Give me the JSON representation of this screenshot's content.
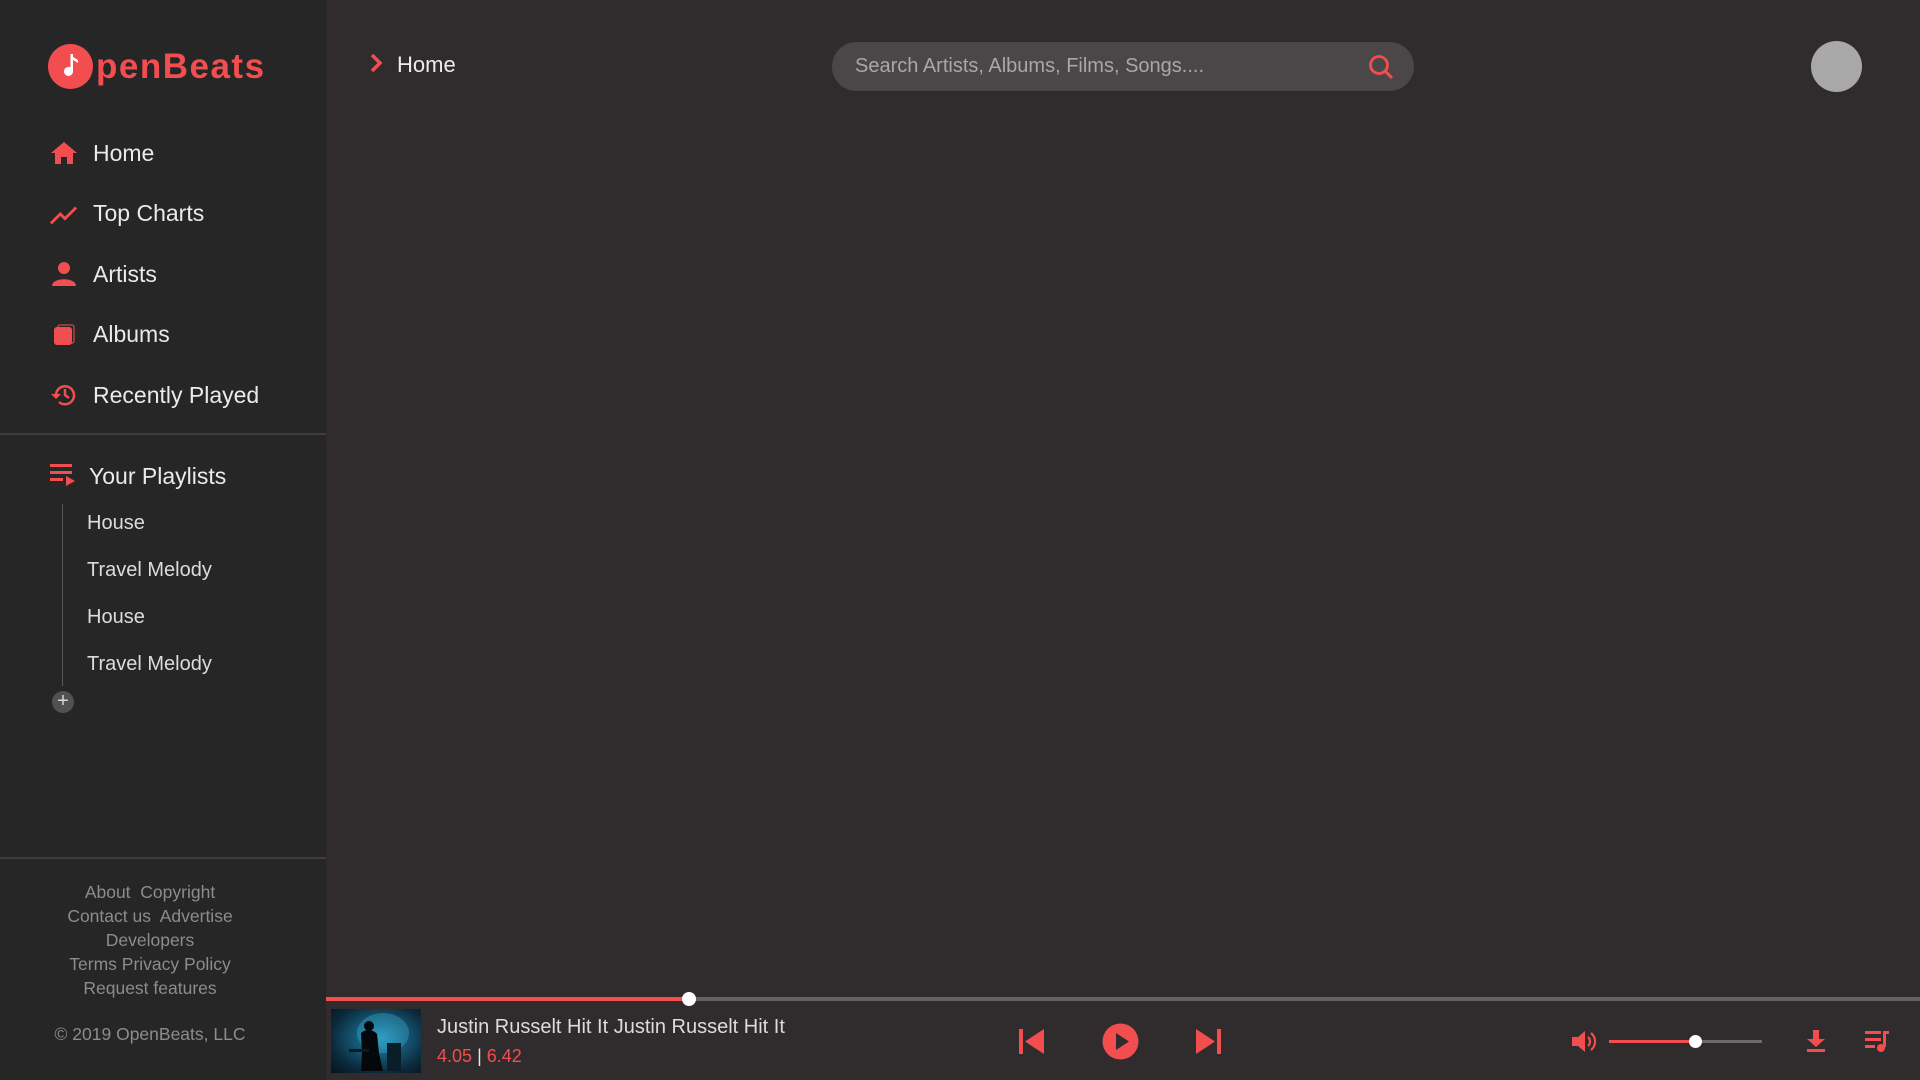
{
  "brand": {
    "logo_accent": "O",
    "logo_rest": "penBeats",
    "accent_color": "#f24e50"
  },
  "sidebar": {
    "nav": [
      {
        "label": "Home",
        "icon": "home-icon"
      },
      {
        "label": "Top Charts",
        "icon": "trending-icon"
      },
      {
        "label": "Artists",
        "icon": "person-icon"
      },
      {
        "label": "Albums",
        "icon": "album-icon"
      },
      {
        "label": "Recently Played",
        "icon": "history-icon"
      }
    ],
    "playlists_title": "Your Playlists",
    "playlists": [
      "House",
      "Travel Melody",
      "House",
      "Travel Melody"
    ],
    "add_playlist_label": "+",
    "footer": {
      "links_row1": [
        "About",
        "Copyright"
      ],
      "links_row2": [
        "Contact us",
        "Advertise"
      ],
      "links_row3": [
        "Developers"
      ],
      "links_row4": [
        "Terms",
        "Privacy Policy"
      ],
      "links_row5": [
        "Request features"
      ],
      "copyright": "© 2019 OpenBeats, LLC"
    }
  },
  "header": {
    "breadcrumb": "Home",
    "search_placeholder": "Search Artists, Albums, Films, Songs...."
  },
  "player": {
    "track_title": "Justin Russelt Hit It Justin Russelt Hit It",
    "current_time": "4.05",
    "separator": "|",
    "total_time": "6.42",
    "progress_fraction": 0.228,
    "volume_fraction": 0.56
  }
}
